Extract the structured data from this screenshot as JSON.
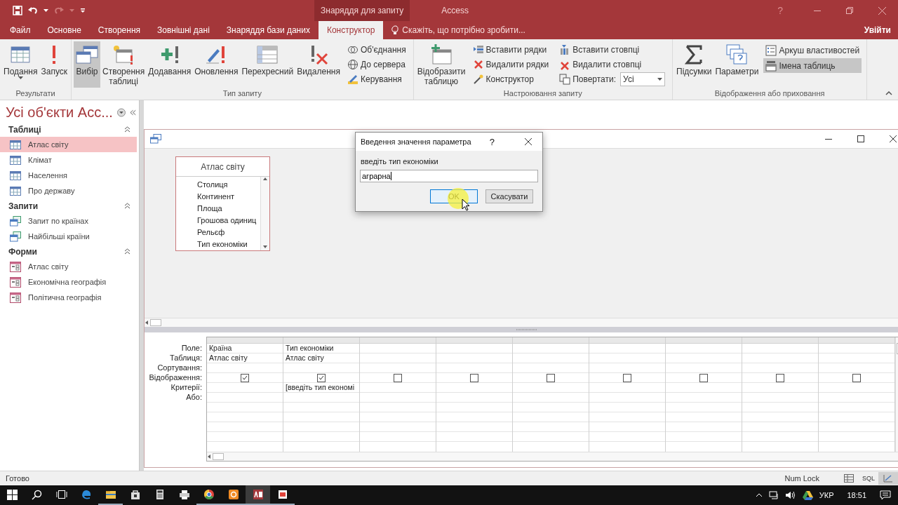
{
  "title_bar": {
    "context_tab": "Знаряддя для запиту",
    "app_name": "Access",
    "help": "?"
  },
  "ribbon_tabs": [
    {
      "label": "Файл",
      "selected": false
    },
    {
      "label": "Основне",
      "selected": false
    },
    {
      "label": "Створення",
      "selected": false
    },
    {
      "label": "Зовнішні дані",
      "selected": false
    },
    {
      "label": "Знаряддя бази даних",
      "selected": false
    },
    {
      "label": "Конструктор",
      "selected": true
    }
  ],
  "tell_me": {
    "placeholder": "Скажіть, що потрібно зробити..."
  },
  "sign_in": "Увійти",
  "ribbon_groups": [
    {
      "label": "Результати",
      "items": [
        {
          "kind": "large",
          "label": "Подання",
          "dropdown": true,
          "selected": false
        },
        {
          "kind": "large",
          "label": "Запуск",
          "dropdown": false,
          "selected": false
        }
      ]
    },
    {
      "label": "Тип запиту",
      "items": [
        {
          "kind": "large",
          "label": "Вибір",
          "dropdown": false,
          "selected": true
        },
        {
          "kind": "large",
          "label": "Створення\nтаблиці",
          "dropdown": false,
          "selected": false
        },
        {
          "kind": "large",
          "label": "Додавання",
          "dropdown": false,
          "selected": false
        },
        {
          "kind": "large",
          "label": "Оновлення",
          "dropdown": false,
          "selected": false
        },
        {
          "kind": "large",
          "label": "Перехресний",
          "dropdown": false,
          "selected": false
        },
        {
          "kind": "large",
          "label": "Видалення",
          "dropdown": false,
          "selected": false
        },
        {
          "kind": "column",
          "items": [
            {
              "kind": "small",
              "label": "Об'єднання",
              "selected": false
            },
            {
              "kind": "small",
              "label": "До сервера",
              "selected": false
            },
            {
              "kind": "small",
              "label": "Керування",
              "selected": false
            }
          ]
        }
      ]
    },
    {
      "label": "Настроювання запиту",
      "items": [
        {
          "kind": "large",
          "label": "Відобразити\nтаблицю",
          "dropdown": false,
          "selected": false
        },
        {
          "kind": "column",
          "items": [
            {
              "kind": "small",
              "label": "Вставити рядки",
              "selected": false
            },
            {
              "kind": "small",
              "label": "Видалити рядки",
              "selected": false
            },
            {
              "kind": "small",
              "label": "Конструктор",
              "selected": false
            }
          ]
        },
        {
          "kind": "column",
          "items": [
            {
              "kind": "small",
              "label": "Вставити стовпці",
              "selected": false
            },
            {
              "kind": "small",
              "label": "Видалити стовпці",
              "selected": false
            },
            {
              "kind": "combo",
              "label": "Повертати:",
              "value": "Усі"
            }
          ]
        }
      ]
    },
    {
      "label": "Відображення або приховання",
      "items": [
        {
          "kind": "large",
          "label": "Підсумки",
          "dropdown": false,
          "selected": false
        },
        {
          "kind": "large",
          "label": "Параметри",
          "dropdown": false,
          "selected": false
        },
        {
          "kind": "column",
          "items": [
            {
              "kind": "small",
              "label": "Аркуш властивостей",
              "selected": false
            },
            {
              "kind": "small",
              "label": "Імена таблиць",
              "selected": true
            }
          ]
        }
      ]
    }
  ],
  "nav_pane": {
    "title": "Усі об'єкти Асс...",
    "sections": [
      {
        "label": "Таблиці",
        "kind": "table",
        "expanded": true,
        "items": [
          {
            "label": "Атлас світу",
            "selected": true
          },
          {
            "label": "Клімат",
            "selected": false
          },
          {
            "label": "Населення",
            "selected": false
          },
          {
            "label": "Про державу",
            "selected": false
          }
        ]
      },
      {
        "label": "Запити",
        "kind": "query",
        "expanded": true,
        "items": [
          {
            "label": "Запит по країнах",
            "selected": false
          },
          {
            "label": "Найбільші країни",
            "selected": false
          }
        ]
      },
      {
        "label": "Форми",
        "kind": "form",
        "expanded": true,
        "items": [
          {
            "label": "Атлас світу",
            "selected": false
          },
          {
            "label": "Економічна географія",
            "selected": false
          },
          {
            "label": "Політична географія",
            "selected": false
          }
        ]
      }
    ]
  },
  "query": {
    "field_list": {
      "title": "Атлас світу",
      "fields": [
        "Столиця",
        "Континент",
        "Площа",
        "Грошова одиниц",
        "Рельєф",
        "Тип економіки"
      ]
    },
    "row_labels": [
      "Поле:",
      "Таблиця:",
      "Сортування:",
      "Відображення:",
      "Критерії:",
      "Або:"
    ],
    "columns": [
      {
        "field": "Країна",
        "table": "Атлас світу",
        "show": true
      },
      {
        "field": "Тип економіки",
        "table": "Атлас світу",
        "show": true,
        "criteria": "[введіть тип економі"
      },
      {
        "show": false
      },
      {
        "show": false
      },
      {
        "show": false
      },
      {
        "show": false
      },
      {
        "show": false
      },
      {
        "show": false
      },
      {
        "show": false
      }
    ]
  },
  "dialog": {
    "title": "Введення значення параметра",
    "help": "?",
    "prompt": "введіть тип економіки",
    "value": "аграрна",
    "buttons": [
      {
        "label": "OK",
        "focused": true
      },
      {
        "label": "Скасувати",
        "focused": false
      }
    ]
  },
  "status_bar": {
    "text": "Готово",
    "num_lock": "Num Lock",
    "views": [
      {
        "kind": "datasheet",
        "selected": false
      },
      {
        "kind": "sql",
        "label": "SQL",
        "selected": false
      },
      {
        "kind": "design",
        "selected": true
      }
    ]
  },
  "taskbar": {
    "apps": [
      {
        "kind": "edge",
        "running": false,
        "active": false
      },
      {
        "kind": "explorer",
        "running": true,
        "active": false
      },
      {
        "kind": "store",
        "running": false,
        "active": false
      },
      {
        "kind": "calculator",
        "running": false,
        "active": false
      },
      {
        "kind": "printer",
        "running": false,
        "active": false
      },
      {
        "kind": "chrome",
        "running": true,
        "active": false
      },
      {
        "kind": "orange",
        "running": true,
        "active": false
      },
      {
        "kind": "access",
        "running": true,
        "active": true
      },
      {
        "kind": "office",
        "running": true,
        "active": false
      }
    ],
    "language": "УКР",
    "time": "18:51"
  }
}
